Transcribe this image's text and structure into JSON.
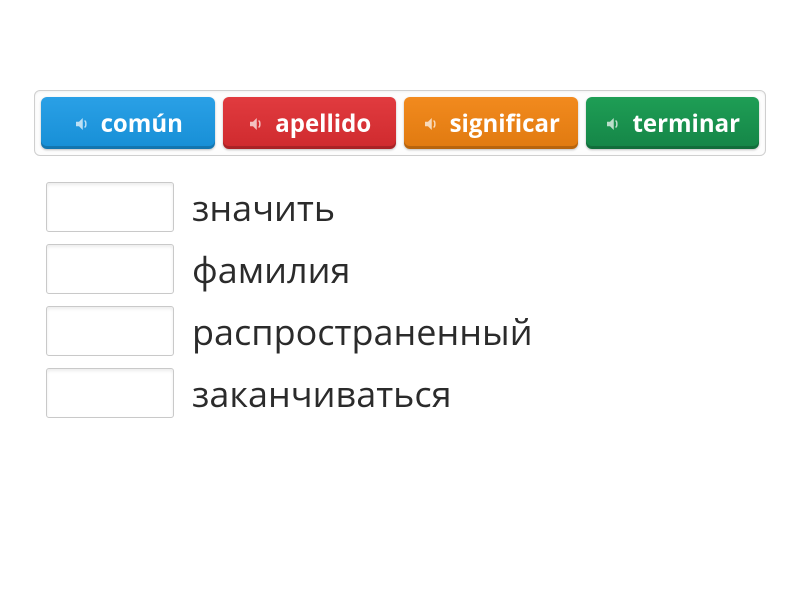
{
  "tiles": [
    {
      "label": "común",
      "color": "blue"
    },
    {
      "label": "apellido",
      "color": "red"
    },
    {
      "label": "significar",
      "color": "orange"
    },
    {
      "label": "terminar",
      "color": "green"
    }
  ],
  "pairs": [
    {
      "label": "значить"
    },
    {
      "label": "фамилия"
    },
    {
      "label": "распространенный"
    },
    {
      "label": "заканчиваться"
    }
  ]
}
